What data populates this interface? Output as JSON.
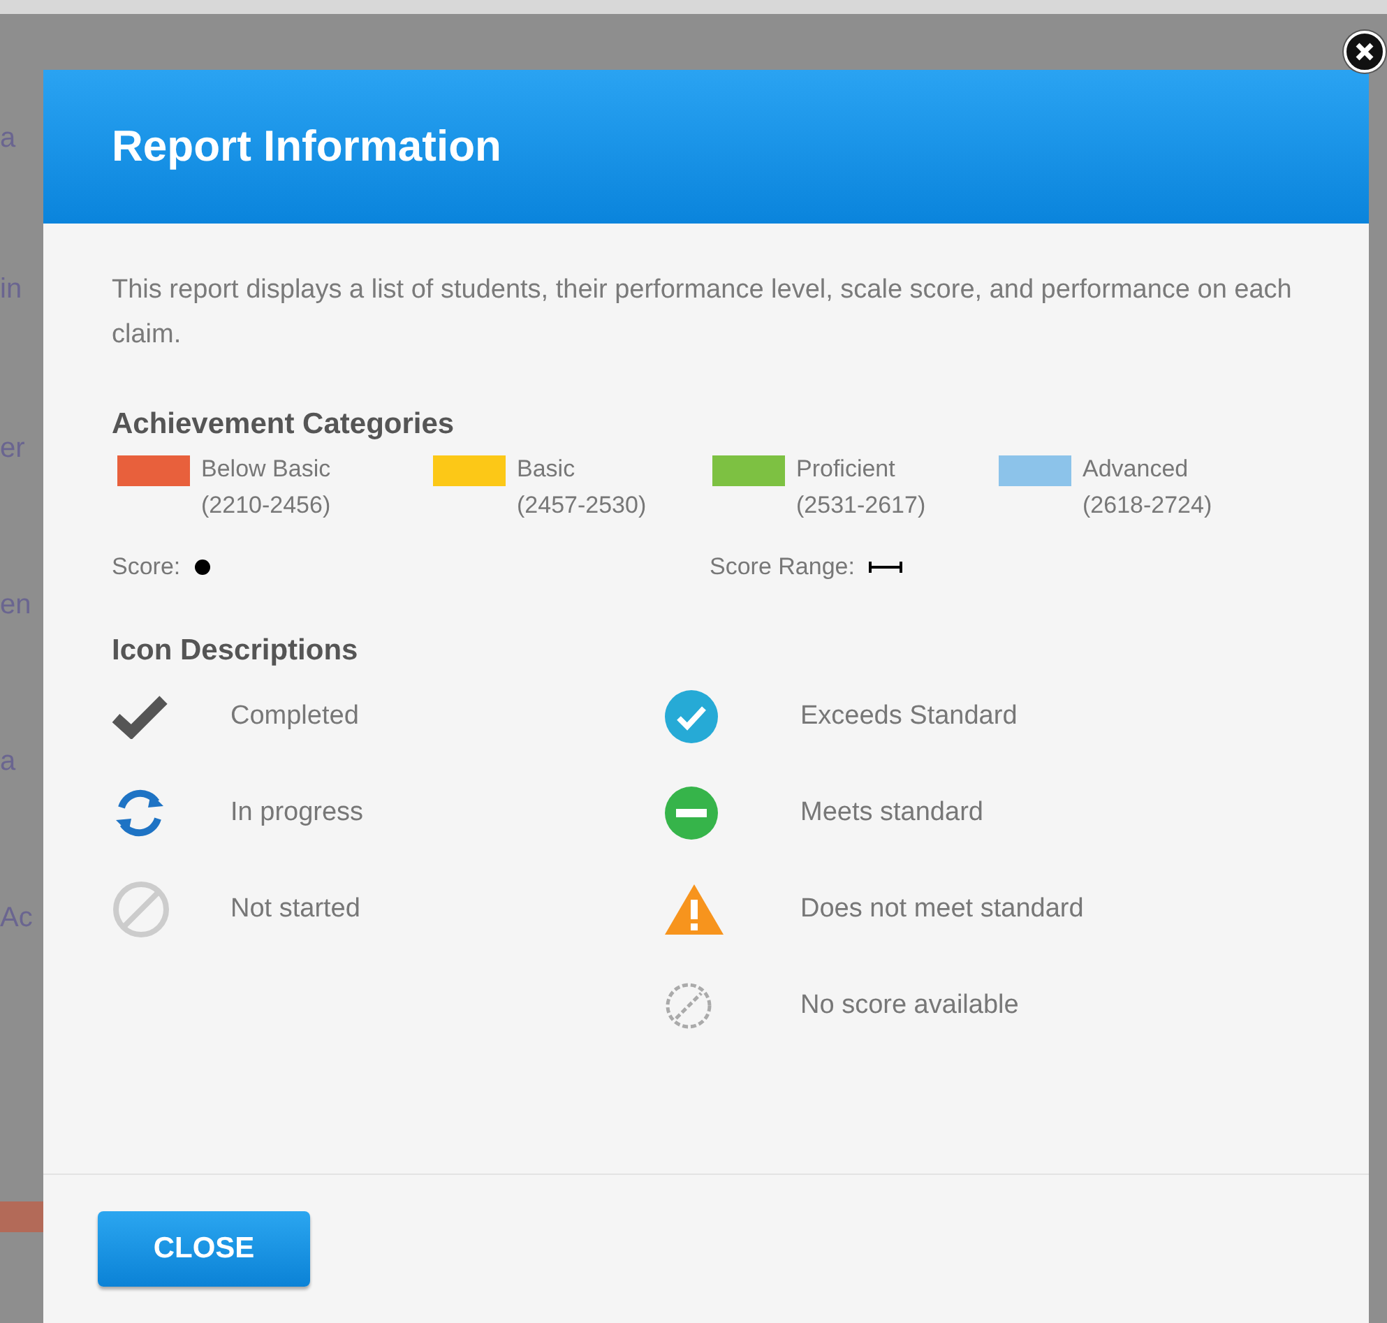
{
  "background": {
    "fragments": [
      "a",
      "in",
      "er",
      "en",
      "a",
      "Ac"
    ]
  },
  "dialog": {
    "title": "Report Information",
    "description": "This report displays a list of students, their performance level, scale score, and performance on each claim.",
    "achievement": {
      "heading": "Achievement Categories",
      "categories": [
        {
          "label": "Below Basic",
          "range": "(2210-2456)",
          "color": "#e8603c"
        },
        {
          "label": "Basic",
          "range": "(2457-2530)",
          "color": "#fcc817"
        },
        {
          "label": "Proficient",
          "range": "(2531-2617)",
          "color": "#7dc142"
        },
        {
          "label": "Advanced",
          "range": "(2618-2724)",
          "color": "#8cc3ea"
        }
      ],
      "score_label": "Score:",
      "score_range_label": "Score Range:"
    },
    "icons": {
      "heading": "Icon Descriptions",
      "left": [
        {
          "kind": "check",
          "label": "Completed"
        },
        {
          "kind": "progress",
          "label": "In progress"
        },
        {
          "kind": "notstarted",
          "label": "Not started"
        }
      ],
      "right": [
        {
          "kind": "exceeds",
          "label": "Exceeds Standard"
        },
        {
          "kind": "meets",
          "label": "Meets standard"
        },
        {
          "kind": "warning",
          "label": "Does not meet standard"
        },
        {
          "kind": "noscore",
          "label": "No score available"
        }
      ]
    },
    "close_button": "CLOSE"
  }
}
